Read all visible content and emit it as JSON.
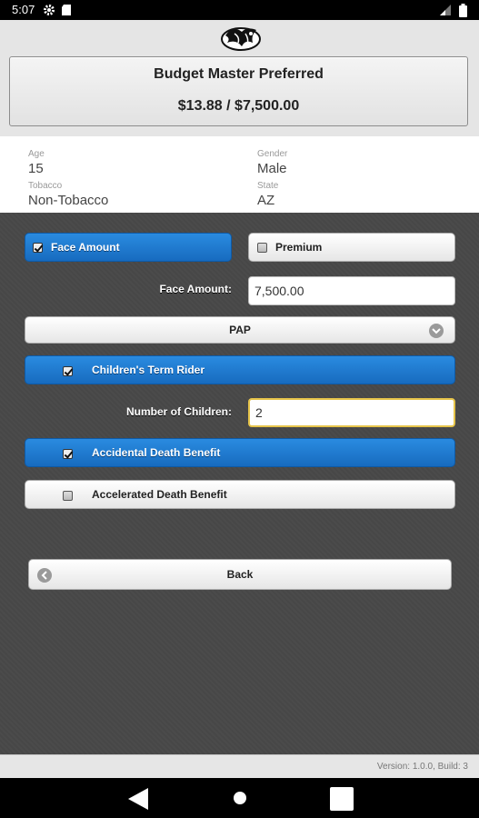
{
  "status_bar": {
    "time": "5:07"
  },
  "header": {
    "plan_name": "Budget Master Preferred",
    "plan_price": "$13.88 / $7,500.00"
  },
  "info": {
    "age_label": "Age",
    "age_value": "15",
    "gender_label": "Gender",
    "gender_value": "Male",
    "tobacco_label": "Tobacco",
    "tobacco_value": "Non-Tobacco",
    "state_label": "State",
    "state_value": "AZ"
  },
  "form": {
    "face_amount_toggle": "Face Amount",
    "premium_toggle": "Premium",
    "face_amount_label": "Face Amount:",
    "face_amount_value": "7,500.00",
    "payment_select": "PAP",
    "childrens_term_rider": "Children's Term Rider",
    "number_of_children_label": "Number of Children:",
    "number_of_children_value": "2",
    "accidental_death_benefit": "Accidental Death Benefit",
    "accelerated_death_benefit": "Accelerated Death Benefit",
    "back_button": "Back"
  },
  "footer": {
    "version": "Version: 1.0.0, Build: 3"
  },
  "colors": {
    "accent_blue": "#1f7bd0",
    "background": "#474747",
    "focus": "#e6c44a"
  }
}
